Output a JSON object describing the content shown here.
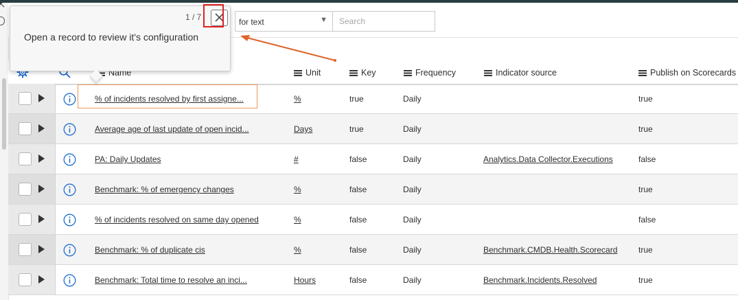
{
  "toolbar": {
    "field_select": "for text",
    "search_placeholder": "Search"
  },
  "tour": {
    "step": "1 / 7",
    "message": "Open a record to review it's configuration"
  },
  "columns": {
    "name": "Name",
    "unit": "Unit",
    "key": "Key",
    "frequency": "Frequency",
    "indicator_source": "Indicator source",
    "publish": "Publish on Scorecards"
  },
  "rows": [
    {
      "name": "% of incidents resolved by first assigne...",
      "unit": "%",
      "key": "true",
      "frequency": "Daily",
      "indicator_source": "",
      "publish": "true"
    },
    {
      "name": "Average age of last update of open incid...",
      "unit": "Days",
      "key": "true",
      "frequency": "Daily",
      "indicator_source": "",
      "publish": "true"
    },
    {
      "name": "PA: Daily Updates",
      "unit": "#",
      "key": "false",
      "frequency": "Daily",
      "indicator_source": "Analytics.Data Collector.Executions",
      "publish": "false"
    },
    {
      "name": "Benchmark: % of emergency changes",
      "unit": "%",
      "key": "false",
      "frequency": "Daily",
      "indicator_source": "",
      "publish": "true"
    },
    {
      "name": "% of incidents resolved on same day opened",
      "unit": "%",
      "key": "false",
      "frequency": "Daily",
      "indicator_source": "",
      "publish": "false"
    },
    {
      "name": "Benchmark: % of duplicate cis",
      "unit": "%",
      "key": "false",
      "frequency": "Daily",
      "indicator_source": "Benchmark.CMDB.Health.Scorecard",
      "publish": "true"
    },
    {
      "name": "Benchmark: Total time to resolve an inci...",
      "unit": "Hours",
      "key": "false",
      "frequency": "Daily",
      "indicator_source": "Benchmark.Incidents.Resolved",
      "publish": "true"
    }
  ],
  "colors": {
    "accent_blue": "#1f6fd1",
    "highlight_orange": "#f0955b",
    "annotation_red": "#e02020",
    "annotation_arrow": "#e0632a"
  },
  "icons": {
    "gear": "gear-icon",
    "search": "search-icon",
    "info": "info-icon",
    "close": "close-icon",
    "expand": "caret-right-icon",
    "column_menu": "menu-icon"
  }
}
